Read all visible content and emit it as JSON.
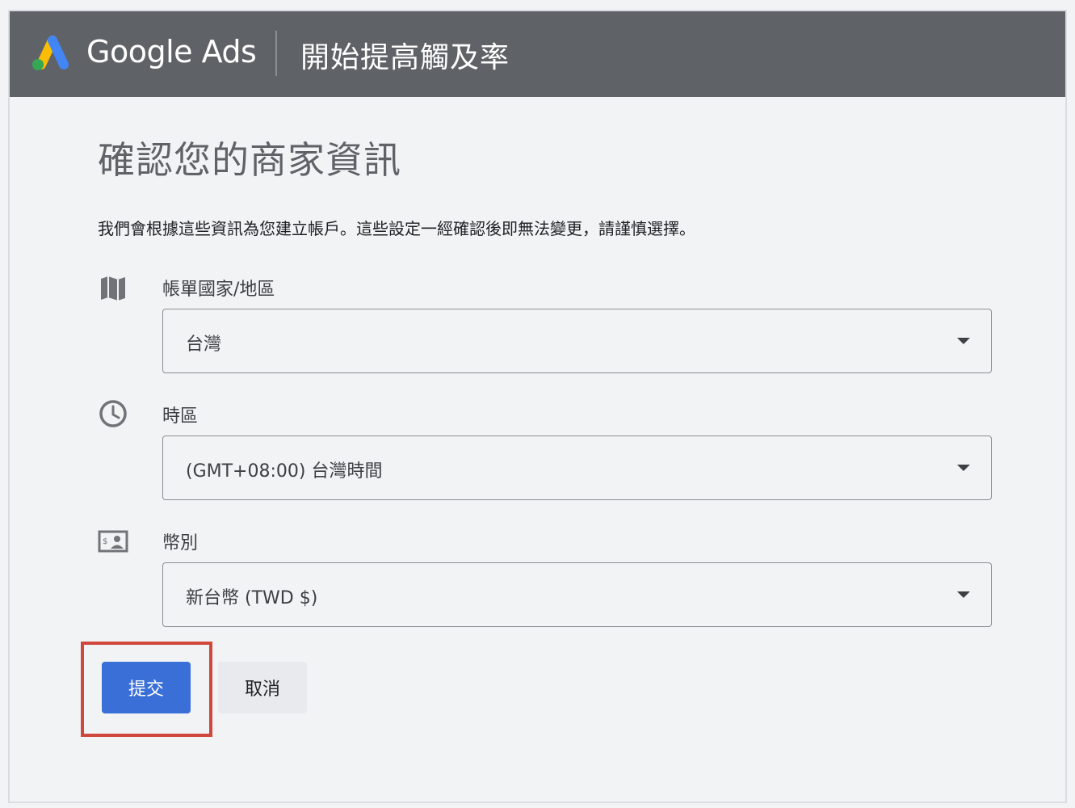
{
  "header": {
    "brand": "Google Ads",
    "title": "開始提高觸及率"
  },
  "page": {
    "title": "確認您的商家資訊",
    "subtitle": "我們會根據這些資訊為您建立帳戶。這些設定一經確認後即無法變更，請謹慎選擇。"
  },
  "fields": [
    {
      "label": "帳單國家/地區",
      "value": "台灣",
      "icon": "map-icon"
    },
    {
      "label": "時區",
      "value": "(GMT+08:00) 台灣時間",
      "icon": "clock-icon"
    },
    {
      "label": "幣別",
      "value": "新台幣 (TWD $)",
      "icon": "currency-icon"
    }
  ],
  "actions": {
    "submit_label": "提交",
    "cancel_label": "取消"
  },
  "colors": {
    "header_bg": "#5f6368",
    "primary": "#3a6fd8",
    "highlight": "#d0483d",
    "logo_blue": "#4285f4",
    "logo_yellow": "#fbbc04",
    "logo_green": "#34a853"
  }
}
